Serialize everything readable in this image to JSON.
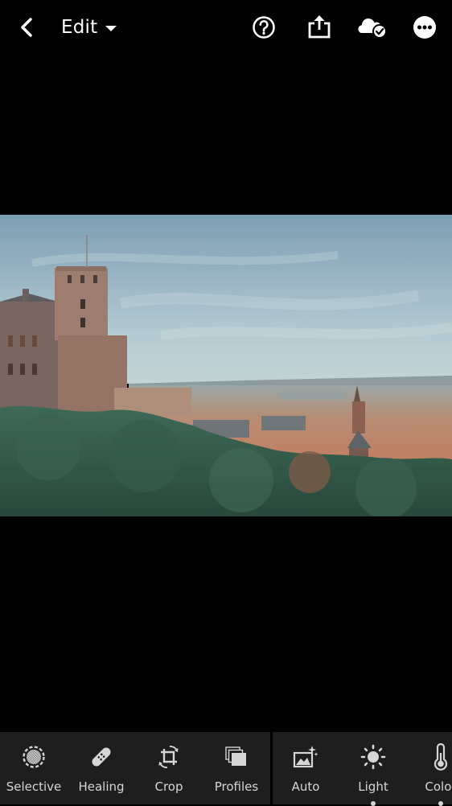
{
  "header": {
    "back_icon": "chevron-left-icon",
    "title": "Edit",
    "title_dropdown_icon": "caret-down-icon",
    "actions": [
      {
        "name": "help",
        "icon": "question-circle-icon"
      },
      {
        "name": "share",
        "icon": "share-upload-icon"
      },
      {
        "name": "cloud-sync",
        "icon": "cloud-check-icon"
      },
      {
        "name": "more",
        "icon": "more-dots-icon"
      }
    ]
  },
  "photo": {
    "description": "Heidelberg castle tower overlooking the old town rooftops, church spire, river and green trees under a pale blue sky"
  },
  "toolbar": {
    "group1": [
      {
        "label": "Selective",
        "icon": "selective-mask-icon"
      },
      {
        "label": "Healing",
        "icon": "bandage-icon"
      },
      {
        "label": "Crop",
        "icon": "crop-rotate-icon"
      },
      {
        "label": "Profiles",
        "icon": "profiles-stack-icon"
      }
    ],
    "group2": [
      {
        "label": "Auto",
        "icon": "auto-magic-image-icon",
        "modified": false
      },
      {
        "label": "Light",
        "icon": "sun-icon",
        "modified": true
      },
      {
        "label": "Color",
        "icon": "thermometer-icon",
        "modified": true
      }
    ]
  },
  "colors": {
    "background": "#000000",
    "toolbar_bg": "#1e1e1e",
    "icon_label": "#d6d6d6"
  }
}
